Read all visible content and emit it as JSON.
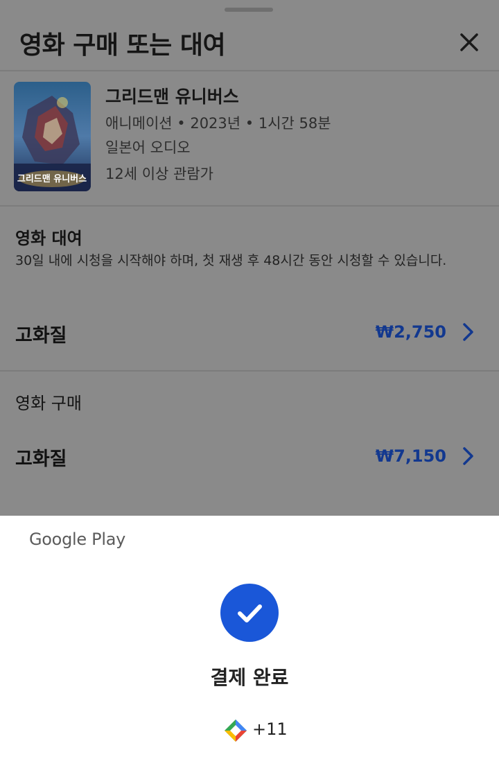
{
  "sheet": {
    "title": "영화 구매 또는 대여"
  },
  "movie": {
    "title": "그리드맨 유니버스",
    "meta": "애니메이션 • 2023년 • 1시간 58분",
    "audio": "일본어 오디오",
    "rating": "12세 이상 관람가",
    "poster_text": "그리드맨 유니버스"
  },
  "rental": {
    "section_title": "영화 대여",
    "description": "30일 내에 시청을 시작해야 하며, 첫 재생 후 48시간 동안 시청할 수 있습니다.",
    "quality_label": "고화질",
    "price": "₩2,750"
  },
  "purchase": {
    "section_title": "영화 구매",
    "quality_label": "고화질",
    "price": "₩7,150"
  },
  "payment": {
    "brand": "Google Play",
    "status": "결제 완료",
    "points": "+11"
  },
  "colors": {
    "accent": "#1a57d8",
    "price": "#12388f"
  }
}
